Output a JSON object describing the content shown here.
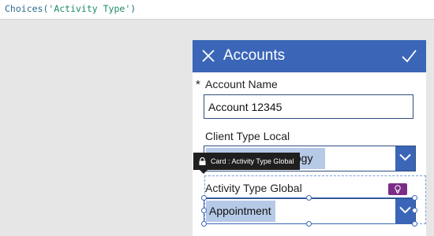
{
  "formula_bar": {
    "func": "Choices(",
    "arg": "'Activity Type'",
    "close": ")"
  },
  "form": {
    "title": "Accounts",
    "fields": {
      "account_name": {
        "required_marker": "*",
        "label": "Account Name",
        "value": "Account 12345"
      },
      "client_type": {
        "label": "Client Type Local",
        "selected": "ology"
      },
      "activity_type": {
        "label": "Activity Type Global",
        "selected": "Appointment"
      }
    }
  },
  "tooltip": {
    "text": "Card : Activity Type Global"
  },
  "icons": {
    "close": "close-icon",
    "confirm": "checkmark-icon",
    "dropdown": "chevron-down-icon",
    "lock": "lock-icon",
    "hint": "lightbulb-icon"
  },
  "colors": {
    "header": "#3b66b8",
    "selection_fill": "#b6c9e6",
    "tooltip_bg": "#1f1f1f",
    "hint_badge": "#7b2d86"
  }
}
